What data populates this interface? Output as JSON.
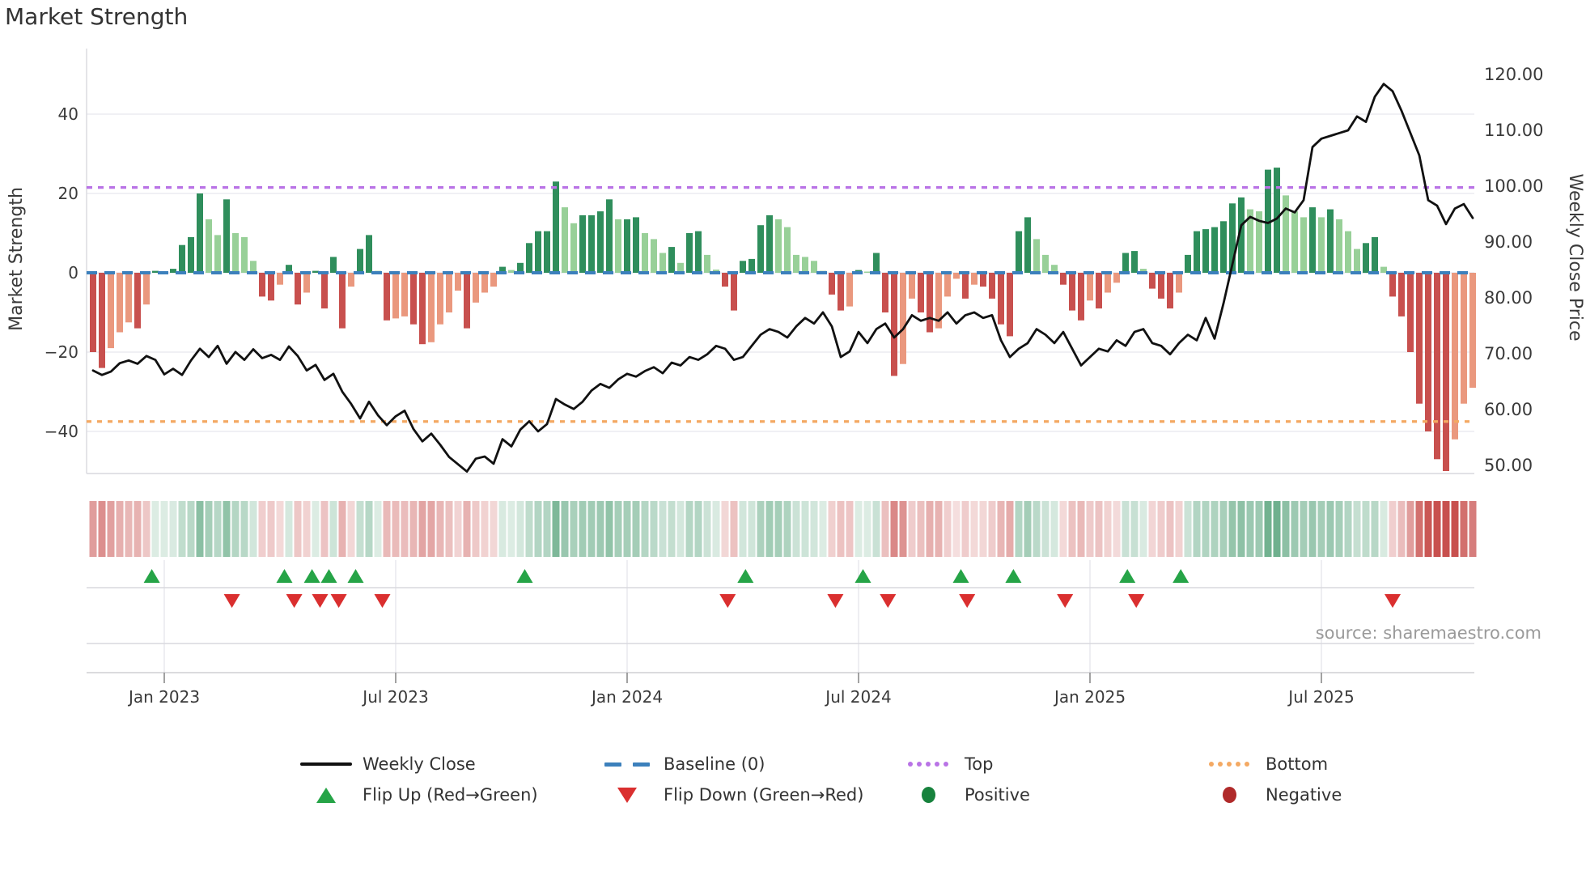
{
  "title": "Market Strength",
  "source": "source: sharemaestro.com",
  "legend": {
    "items": [
      {
        "label": "Weekly Close"
      },
      {
        "label": "Baseline (0)"
      },
      {
        "label": "Top"
      },
      {
        "label": "Bottom"
      },
      {
        "label": "Flip Up (Red→Green)"
      },
      {
        "label": "Flip Down (Green→Red)"
      },
      {
        "label": "Positive"
      },
      {
        "label": "Negative"
      }
    ]
  },
  "chart_data": {
    "type": "bar",
    "subtype": "combo-bar-line-heatmap",
    "title": "Market Strength",
    "ylabel": "Market Strength",
    "ylabel_right": "Weekly Close Price",
    "xlabel": "",
    "ylim_left": [
      -52,
      52
    ],
    "ylim_right": [
      48,
      122
    ],
    "grid": "horizontal-only",
    "legend_position": "bottom",
    "x_tick_labels": [
      "Jan 2023",
      "Jul 2023",
      "Jan 2024",
      "Jul 2024",
      "Jan 2025",
      "Jul 2025"
    ],
    "x_tick_weeks": [
      8,
      34,
      60,
      86,
      112,
      138
    ],
    "left_tick_labels": [
      "40",
      "20",
      "0",
      "−20",
      "−40"
    ],
    "left_tick_values": [
      40,
      20,
      0,
      -20,
      -40
    ],
    "right_tick_labels": [
      "120.00",
      "110.00",
      "100.00",
      "90.00",
      "80.00",
      "70.00",
      "60.00",
      "50.00"
    ],
    "right_tick_values": [
      120,
      110,
      100,
      90,
      80,
      70,
      60,
      50
    ],
    "top_line_value": 21.5,
    "bottom_line_value": -37.5,
    "baseline_value": 0,
    "series": [
      {
        "name": "Market Strength bars",
        "values": [
          -20,
          -24,
          -19,
          -15,
          -12.5,
          -14,
          -8,
          0.5,
          0.3,
          1,
          7,
          9,
          20,
          13.5,
          9.5,
          18.5,
          10,
          9,
          3,
          -6,
          -7,
          -3,
          2,
          -8,
          -5,
          0.5,
          -9,
          4,
          -14,
          -3.5,
          6,
          9.5,
          0.5,
          -12,
          -11.5,
          -11,
          -13,
          -18,
          -17.5,
          -13,
          -10,
          -4.5,
          -14,
          -7.5,
          -5,
          -3.5,
          1.5,
          0.7,
          2.5,
          7.5,
          10.5,
          10.5,
          23,
          16.5,
          12.5,
          14.5,
          14.5,
          15.5,
          18.5,
          13.5,
          13.5,
          14,
          10,
          8.5,
          5,
          6.5,
          2.5,
          10,
          10.5,
          4.5,
          0.8,
          -3.5,
          -9.5,
          3,
          3.5,
          12,
          14.5,
          13.5,
          11.5,
          4.5,
          4,
          3,
          0.5,
          -5.5,
          -9.5,
          -8.5,
          0.7,
          0.3,
          5,
          -10,
          -26,
          -23,
          -6.5,
          -10,
          -15,
          -14,
          -6,
          -1.5,
          -6.5,
          -3,
          -3.5,
          -6.5,
          -13,
          -16,
          10.5,
          14,
          8.5,
          4.5,
          2,
          -3,
          -9.5,
          -12,
          -7,
          -9,
          -5,
          -2.5,
          5,
          5.5,
          1,
          -4,
          -6.5,
          -9,
          -5,
          4.5,
          10.5,
          11,
          11.5,
          13,
          17.5,
          19,
          16,
          15.5,
          26,
          26.5,
          19.5,
          15.5,
          14,
          16.5,
          14,
          16,
          13.5,
          10.5,
          6,
          7.5,
          9,
          1.5,
          -6,
          -11,
          -20,
          -33,
          -40,
          -47,
          -50,
          -42,
          -33,
          -29
        ]
      },
      {
        "name": "Weekly Close",
        "values": [
          67,
          66.2,
          66.8,
          68.3,
          68.8,
          68.2,
          69.6,
          68.9,
          66.3,
          67.3,
          66.2,
          68.8,
          70.9,
          69.4,
          71.4,
          68.2,
          70.3,
          68.9,
          70.8,
          69.2,
          69.8,
          68.9,
          71.3,
          69.6,
          67,
          68,
          65.3,
          66.4,
          63.2,
          61,
          58.4,
          61.4,
          59,
          57.2,
          58.8,
          59.8,
          56.5,
          54.3,
          55.7,
          53.7,
          51.5,
          50.2,
          48.9,
          51.2,
          51.6,
          50.3,
          54.7,
          53.4,
          56.4,
          57.9,
          56.1,
          57.4,
          61.9,
          60.9,
          60.1,
          61.4,
          63.4,
          64.6,
          63.9,
          65.4,
          66.4,
          65.9,
          66.9,
          67.6,
          66.5,
          68.4,
          67.9,
          69.4,
          68.9,
          69.9,
          71.4,
          70.9,
          68.9,
          69.4,
          71.4,
          73.4,
          74.4,
          73.9,
          72.9,
          74.9,
          76.4,
          75.4,
          77.4,
          74.9,
          69.4,
          70.4,
          73.9,
          71.9,
          74.4,
          75.4,
          72.9,
          74.4,
          76.9,
          75.9,
          76.4,
          75.9,
          77.4,
          75.4,
          76.9,
          77.4,
          76.4,
          76.9,
          72.4,
          69.4,
          70.9,
          71.9,
          74.4,
          73.4,
          71.9,
          73.9,
          70.9,
          67.9,
          69.4,
          70.9,
          70.4,
          72.4,
          71.4,
          73.9,
          74.4,
          71.9,
          71.4,
          69.9,
          71.9,
          73.4,
          72.4,
          76.4,
          72.7,
          79,
          86,
          93,
          94.5,
          93.8,
          93.4,
          94.2,
          96,
          95.3,
          97.5,
          107,
          108.5,
          109,
          109.5,
          110,
          112.5,
          111.5,
          116,
          118.3,
          117,
          113.5,
          109.5,
          105.5,
          97.5,
          96.5,
          93.2,
          96,
          96.8,
          94.3
        ]
      }
    ],
    "flip_up_weeks": [
      6.6,
      21.5,
      24.6,
      26.5,
      29.5,
      48.5,
      73.3,
      86.5,
      97.5,
      103.4,
      116.2,
      122.2
    ],
    "flip_down_weeks": [
      15.6,
      22.6,
      25.5,
      27.6,
      32.5,
      71.3,
      83.4,
      89.3,
      98.2,
      109.2,
      117.2,
      146
    ],
    "colors": {
      "bar_dark_green": "#2f8e5c",
      "bar_light_green": "#98d098",
      "bar_dark_red": "#c8504e",
      "bar_light_red": "#ea987e",
      "price_line": "#111111",
      "baseline_blue": "#3c80bc",
      "top_purple": "#b973e6",
      "bottom_orange": "#f4a963",
      "flip_up_green": "#26a447",
      "flip_down_red": "#da2f2f",
      "positive_dot": "#17823d",
      "negative_dot": "#b02a2a",
      "gridline": "#ebebf1",
      "separator": "#d9d9de",
      "tick_text": "#3a3a3a",
      "source_text": "#9a9a9a"
    }
  }
}
